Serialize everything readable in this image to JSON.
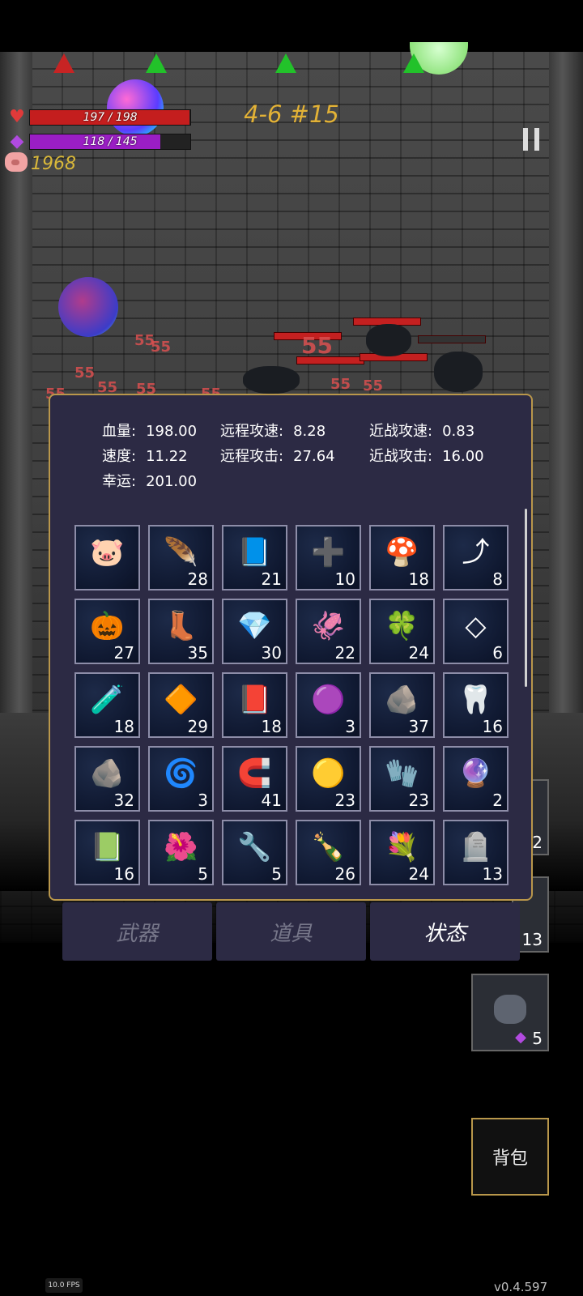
{
  "hud": {
    "hp_text": "197 / 198",
    "hp_fraction": 0.995,
    "mp_text": "118 / 145",
    "mp_fraction": 0.814,
    "gold": "1968",
    "level": "4-6 #15",
    "heart_icon": "heart-icon",
    "mana_icon": "diamond-icon",
    "gold_icon": "pig-icon",
    "pause_icon": "pause-icon",
    "hp_color": "#c41e1e",
    "mp_color": "#9a1ec4"
  },
  "arena": {
    "damage_numbers": [
      "55",
      "55",
      "55",
      "55",
      "55",
      "55",
      "55",
      "55",
      "55",
      "55"
    ]
  },
  "stats": {
    "hp_label": "血量:",
    "hp_value": "198.00",
    "ranged_speed_label": "远程攻速:",
    "ranged_speed_value": "8.28",
    "melee_speed_label": "近战攻速:",
    "melee_speed_value": "0.83",
    "speed_label": "速度:",
    "speed_value": "11.22",
    "ranged_attack_label": "远程攻击:",
    "ranged_attack_value": "27.64",
    "melee_attack_label": "近战攻击:",
    "melee_attack_value": "16.00",
    "luck_label": "幸运:",
    "luck_value": "201.00"
  },
  "items": [
    {
      "icon": "piggy-bank-icon",
      "glyph": "🐷",
      "count": ""
    },
    {
      "icon": "feather-icon",
      "glyph": "🪶",
      "count": "28"
    },
    {
      "icon": "spellbook-icon",
      "glyph": "📘",
      "count": "21"
    },
    {
      "icon": "medkit-icon",
      "glyph": "➕",
      "count": "10"
    },
    {
      "icon": "mushroom-icon",
      "glyph": "🍄",
      "count": "18"
    },
    {
      "icon": "arrow-icon",
      "glyph": "⤴",
      "count": "8"
    },
    {
      "icon": "pumpkin-icon",
      "glyph": "🎃",
      "count": "27"
    },
    {
      "icon": "boots-icon",
      "glyph": "👢",
      "count": "35"
    },
    {
      "icon": "crystal-icon",
      "glyph": "💎",
      "count": "30"
    },
    {
      "icon": "squid-icon",
      "glyph": "🦑",
      "count": "22"
    },
    {
      "icon": "clover-icon",
      "glyph": "🍀",
      "count": "24"
    },
    {
      "icon": "diamond-tile-icon",
      "glyph": "◇",
      "count": "6"
    },
    {
      "icon": "potion-icon",
      "glyph": "🧪",
      "count": "18"
    },
    {
      "icon": "red-crystal-icon",
      "glyph": "🔶",
      "count": "29"
    },
    {
      "icon": "book-icon",
      "glyph": "📕",
      "count": "18"
    },
    {
      "icon": "slime-icon",
      "glyph": "🟣",
      "count": "3"
    },
    {
      "icon": "stones-icon",
      "glyph": "🪨",
      "count": "37"
    },
    {
      "icon": "horn-icon",
      "glyph": "🦷",
      "count": "16"
    },
    {
      "icon": "rock-icon",
      "glyph": "🪨",
      "count": "32"
    },
    {
      "icon": "spiral-rune-icon",
      "glyph": "🌀",
      "count": "3"
    },
    {
      "icon": "horseshoe-icon",
      "glyph": "🧲",
      "count": "41"
    },
    {
      "icon": "gold-coin-icon",
      "glyph": "🟡",
      "count": "23"
    },
    {
      "icon": "gloves-icon",
      "glyph": "🧤",
      "count": "23"
    },
    {
      "icon": "purple-rune-icon",
      "glyph": "🔮",
      "count": "2"
    },
    {
      "icon": "skull-book-icon",
      "glyph": "📗",
      "count": "16"
    },
    {
      "icon": "flower-icon",
      "glyph": "🌺",
      "count": "5"
    },
    {
      "icon": "wrench-icon",
      "glyph": "🔧",
      "count": "5"
    },
    {
      "icon": "bottle-icon",
      "glyph": "🍾",
      "count": "26"
    },
    {
      "icon": "bouquet-icon",
      "glyph": "💐",
      "count": "24"
    },
    {
      "icon": "tombstone-icon",
      "glyph": "🪦",
      "count": "13"
    }
  ],
  "tabs": {
    "weapons": "武器",
    "items": "道具",
    "status": "状态"
  },
  "side_slots": {
    "slot1_count": "2",
    "slot2_count": "13",
    "slot3_count": "5",
    "slot3_icon": "diamond-icon"
  },
  "bag_button": "背包",
  "fps": "10.0 FPS",
  "version": "v0.4.597"
}
